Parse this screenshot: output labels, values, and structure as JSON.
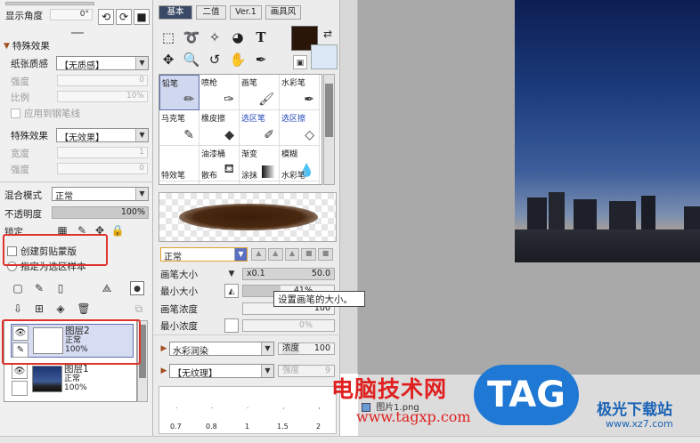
{
  "left": {
    "display_angle_label": "显示角度",
    "display_angle_value": "0°",
    "effects_header": "特殊效果",
    "paper_texture_label": "纸张质感",
    "paper_texture_value": "【无质感】",
    "strength_label": "强度",
    "strength_value": "0",
    "ratio_label": "比例",
    "ratio_value": "10%",
    "apply_to_line_label": "应用到钢笔线",
    "effect_label": "特殊效果",
    "effect_value": "【无效果】",
    "width_label": "宽度",
    "width_value": "1",
    "strength2_label": "强度",
    "strength2_value": "0",
    "blend_label": "混合模式",
    "blend_value": "正常",
    "opacity_label": "不透明度",
    "opacity_value": "100%",
    "lock_label": "锁定",
    "clipping_label": "创建剪贴蒙版",
    "select_source_label": "指定为选区样本",
    "layers": [
      {
        "name": "图层2",
        "mode": "正常",
        "opacity": "100%"
      },
      {
        "name": "图层1",
        "mode": "正常",
        "opacity": "100%"
      }
    ]
  },
  "middle": {
    "tabs": [
      "基本",
      "二值",
      "Ver.1",
      "画具风"
    ],
    "brushes": [
      {
        "name": "铅笔",
        "icon": "pencil-icon",
        "blue": false
      },
      {
        "name": "喷枪",
        "icon": "airbrush-icon",
        "blue": false
      },
      {
        "name": "画笔",
        "icon": "brush-icon",
        "blue": false
      },
      {
        "name": "水彩笔",
        "icon": "watercolor-icon",
        "blue": false
      },
      {
        "name": "马克笔",
        "icon": "marker-icon",
        "blue": false
      },
      {
        "name": "橡皮擦",
        "icon": "eraser-icon",
        "blue": false
      },
      {
        "name": "选区笔",
        "icon": "select-pen-icon",
        "blue": true
      },
      {
        "name": "选区擦",
        "icon": "select-eraser-icon",
        "blue": true
      },
      {
        "name": "",
        "icon": "",
        "blue": false
      },
      {
        "name": "油漆桶",
        "icon": "bucket-icon",
        "blue": false
      },
      {
        "name": "渐变",
        "icon": "gradient-icon",
        "blue": false
      },
      {
        "name": "模糊",
        "icon": "blur-icon",
        "blue": false
      },
      {
        "name": "特效笔",
        "icon": "fx-pen-icon",
        "blue": false
      },
      {
        "name": "散布",
        "icon": "scatter-icon",
        "blue": false
      },
      {
        "name": "涂抹",
        "icon": "smudge-icon",
        "blue": false
      },
      {
        "name": "水彩笔",
        "icon": "watercolor-icon",
        "blue": false
      }
    ],
    "brush_mode": "正常",
    "brush_size_label": "画笔大小",
    "brush_size_mult": "x0.1",
    "brush_size_value": "50.0",
    "min_size_label": "最小大小",
    "min_size_value": "41%",
    "brush_density_label": "画笔浓度",
    "brush_density_value": "100",
    "min_density_label": "最小浓度",
    "min_density_value": "0%",
    "blend_dropdown": "水彩润染",
    "density_label": "浓度",
    "density_value": "100",
    "texture_dropdown": "【无纹理】",
    "texture_strength_label": "强度",
    "texture_strength_value": "9",
    "size_ticks": [
      "0.7",
      "0.8",
      "1",
      "1.5",
      "2"
    ]
  },
  "tooltip": "设置画笔的大小。",
  "file_tab": "图片1.png",
  "watermark": {
    "site_cn": "电脑技术网",
    "site_url": "www.tagxp.com",
    "tag": "TAG",
    "jg_name": "极光下载站",
    "jg_url": "www.xz7.com"
  },
  "colors": {
    "highlight": "#e0322c",
    "primary_color": "#2a1608",
    "secondary_color": "#dde8f7"
  }
}
